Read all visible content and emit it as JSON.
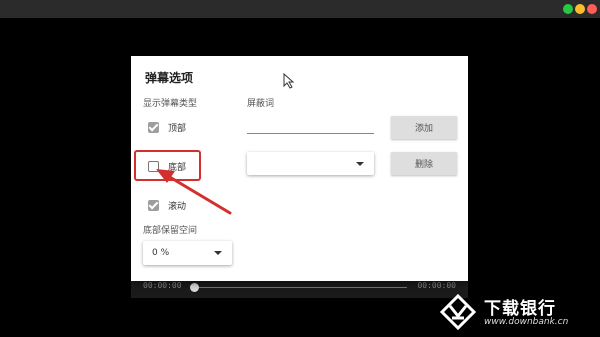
{
  "window": {
    "controls": [
      "green",
      "yellow",
      "red"
    ]
  },
  "dialog": {
    "title": "弹幕选项",
    "type_section_label": "显示弹幕类型",
    "checkboxes": [
      {
        "label": "顶部",
        "checked": true
      },
      {
        "label": "底部",
        "checked": false
      },
      {
        "label": "滚动",
        "checked": true
      }
    ],
    "bottom_space_label": "底部保留空间",
    "bottom_space_value": "0 %",
    "blocked_words_label": "屏蔽词",
    "blocked_words_input": "",
    "blocked_words_select": "",
    "add_button": "添加",
    "delete_button": "删除"
  },
  "player": {
    "current_time": "00:00:00",
    "total_time": "00:00:00",
    "progress": 0
  },
  "watermark": {
    "name": "下载银行",
    "url": "www.downbank.cn"
  },
  "colors": {
    "highlight": "#d32f2f",
    "background": "#000000",
    "panel": "#ffffff"
  }
}
